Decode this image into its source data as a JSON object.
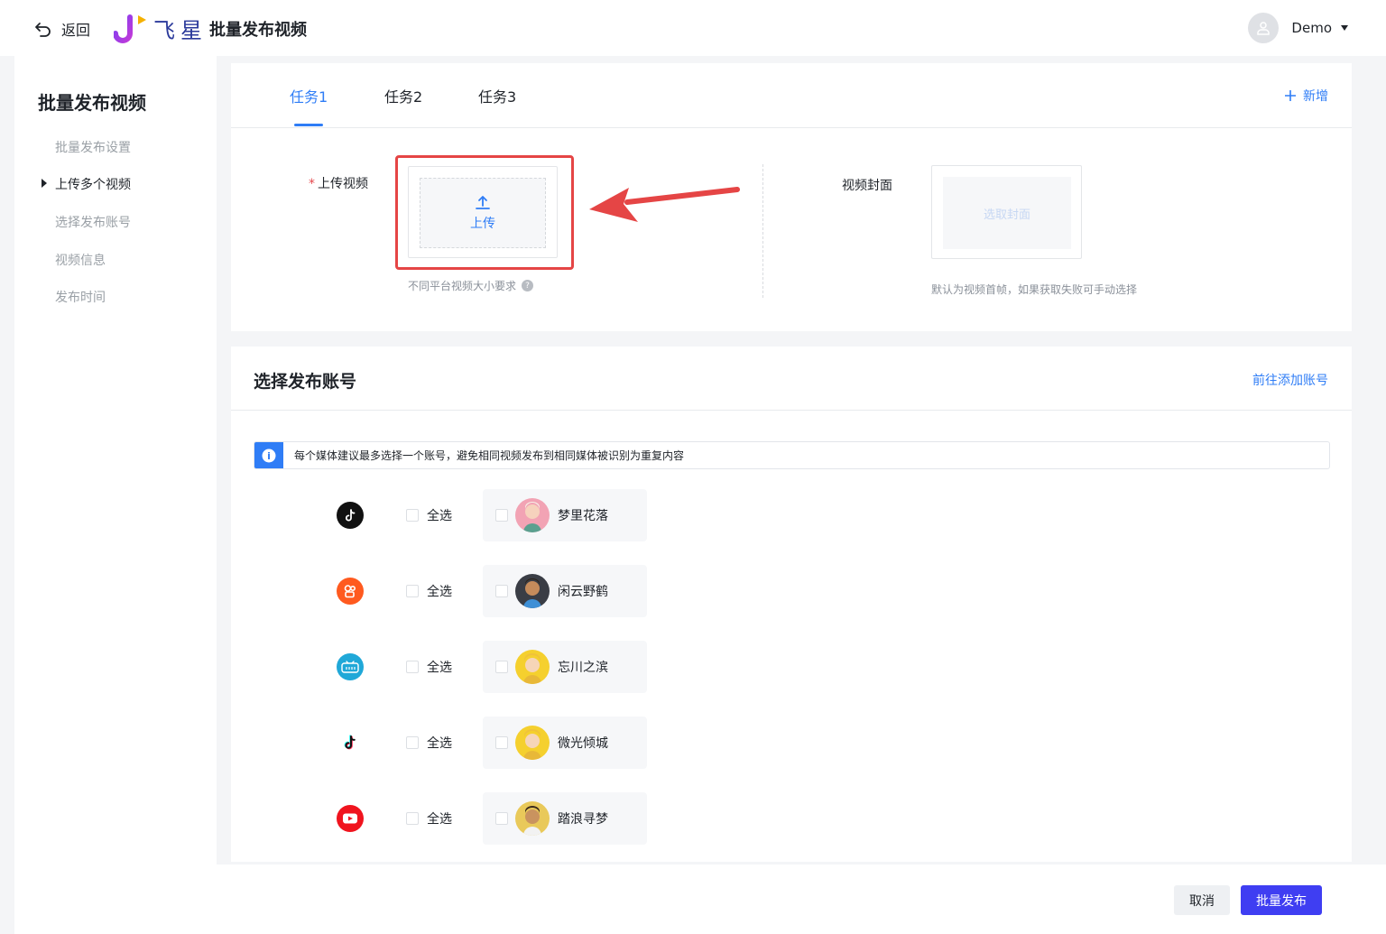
{
  "topbar": {
    "back_label": "返回",
    "logo_text": "飞星",
    "app_title": "批量发布视频",
    "user_name": "Demo"
  },
  "sidebar": {
    "title": "批量发布视频",
    "items": [
      {
        "label": "批量发布设置",
        "active": false
      },
      {
        "label": "上传多个视频",
        "active": true
      },
      {
        "label": "选择发布账号",
        "active": false
      },
      {
        "label": "视频信息",
        "active": false
      },
      {
        "label": "发布时间",
        "active": false
      }
    ]
  },
  "tasks": {
    "tabs": [
      {
        "label": "任务1",
        "active": true
      },
      {
        "label": "任务2",
        "active": false
      },
      {
        "label": "任务3",
        "active": false
      }
    ],
    "add_label": "新增"
  },
  "upload": {
    "label_star": "*",
    "label": "上传视频",
    "button": "上传",
    "hint": "不同平台视频大小要求",
    "hint_icon": "?",
    "cover_label": "视频封面",
    "cover_button": "选取封面",
    "cover_hint": "默认为视频首帧，如果获取失败可手动选择"
  },
  "accounts": {
    "title": "选择发布账号",
    "add_link": "前往添加账号",
    "notice_icon": "i",
    "notice": "每个媒体建议最多选择一个账号，避免相同视频发布到相同媒体被识别为重复内容",
    "rows": [
      {
        "platform_icon": "douyin-icon",
        "select_all": "全选",
        "account": "梦里花落"
      },
      {
        "platform_icon": "kuaishou-icon",
        "select_all": "全选",
        "account": "闲云野鹤"
      },
      {
        "platform_icon": "bilibili-icon",
        "select_all": "全选",
        "account": "忘川之滨"
      },
      {
        "platform_icon": "tiktok-icon",
        "select_all": "全选",
        "account": "微光倾城"
      },
      {
        "platform_icon": "youtube-icon",
        "select_all": "全选",
        "account": "踏浪寻梦"
      }
    ]
  },
  "footer": {
    "cancel": "取消",
    "publish": "批量发布"
  },
  "colors": {
    "accent": "#2f7df6",
    "primary_button": "#3f3ef2",
    "annotation_red": "#e54545"
  }
}
